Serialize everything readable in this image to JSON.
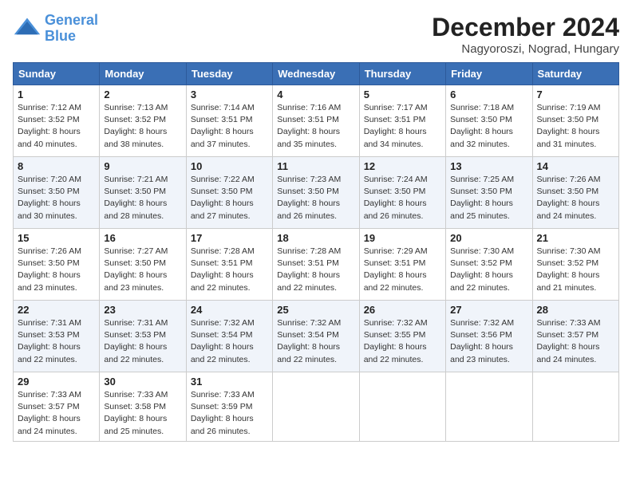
{
  "logo": {
    "line1": "General",
    "line2": "Blue"
  },
  "title": "December 2024",
  "location": "Nagyoroszi, Nograd, Hungary",
  "weekdays": [
    "Sunday",
    "Monday",
    "Tuesday",
    "Wednesday",
    "Thursday",
    "Friday",
    "Saturday"
  ],
  "weeks": [
    [
      {
        "day": 1,
        "sunrise": "7:12 AM",
        "sunset": "3:52 PM",
        "daylight": "8 hours and 40 minutes."
      },
      {
        "day": 2,
        "sunrise": "7:13 AM",
        "sunset": "3:52 PM",
        "daylight": "8 hours and 38 minutes."
      },
      {
        "day": 3,
        "sunrise": "7:14 AM",
        "sunset": "3:51 PM",
        "daylight": "8 hours and 37 minutes."
      },
      {
        "day": 4,
        "sunrise": "7:16 AM",
        "sunset": "3:51 PM",
        "daylight": "8 hours and 35 minutes."
      },
      {
        "day": 5,
        "sunrise": "7:17 AM",
        "sunset": "3:51 PM",
        "daylight": "8 hours and 34 minutes."
      },
      {
        "day": 6,
        "sunrise": "7:18 AM",
        "sunset": "3:50 PM",
        "daylight": "8 hours and 32 minutes."
      },
      {
        "day": 7,
        "sunrise": "7:19 AM",
        "sunset": "3:50 PM",
        "daylight": "8 hours and 31 minutes."
      }
    ],
    [
      {
        "day": 8,
        "sunrise": "7:20 AM",
        "sunset": "3:50 PM",
        "daylight": "8 hours and 30 minutes."
      },
      {
        "day": 9,
        "sunrise": "7:21 AM",
        "sunset": "3:50 PM",
        "daylight": "8 hours and 28 minutes."
      },
      {
        "day": 10,
        "sunrise": "7:22 AM",
        "sunset": "3:50 PM",
        "daylight": "8 hours and 27 minutes."
      },
      {
        "day": 11,
        "sunrise": "7:23 AM",
        "sunset": "3:50 PM",
        "daylight": "8 hours and 26 minutes."
      },
      {
        "day": 12,
        "sunrise": "7:24 AM",
        "sunset": "3:50 PM",
        "daylight": "8 hours and 26 minutes."
      },
      {
        "day": 13,
        "sunrise": "7:25 AM",
        "sunset": "3:50 PM",
        "daylight": "8 hours and 25 minutes."
      },
      {
        "day": 14,
        "sunrise": "7:26 AM",
        "sunset": "3:50 PM",
        "daylight": "8 hours and 24 minutes."
      }
    ],
    [
      {
        "day": 15,
        "sunrise": "7:26 AM",
        "sunset": "3:50 PM",
        "daylight": "8 hours and 23 minutes."
      },
      {
        "day": 16,
        "sunrise": "7:27 AM",
        "sunset": "3:50 PM",
        "daylight": "8 hours and 23 minutes."
      },
      {
        "day": 17,
        "sunrise": "7:28 AM",
        "sunset": "3:51 PM",
        "daylight": "8 hours and 22 minutes."
      },
      {
        "day": 18,
        "sunrise": "7:28 AM",
        "sunset": "3:51 PM",
        "daylight": "8 hours and 22 minutes."
      },
      {
        "day": 19,
        "sunrise": "7:29 AM",
        "sunset": "3:51 PM",
        "daylight": "8 hours and 22 minutes."
      },
      {
        "day": 20,
        "sunrise": "7:30 AM",
        "sunset": "3:52 PM",
        "daylight": "8 hours and 22 minutes."
      },
      {
        "day": 21,
        "sunrise": "7:30 AM",
        "sunset": "3:52 PM",
        "daylight": "8 hours and 21 minutes."
      }
    ],
    [
      {
        "day": 22,
        "sunrise": "7:31 AM",
        "sunset": "3:53 PM",
        "daylight": "8 hours and 22 minutes."
      },
      {
        "day": 23,
        "sunrise": "7:31 AM",
        "sunset": "3:53 PM",
        "daylight": "8 hours and 22 minutes."
      },
      {
        "day": 24,
        "sunrise": "7:32 AM",
        "sunset": "3:54 PM",
        "daylight": "8 hours and 22 minutes."
      },
      {
        "day": 25,
        "sunrise": "7:32 AM",
        "sunset": "3:54 PM",
        "daylight": "8 hours and 22 minutes."
      },
      {
        "day": 26,
        "sunrise": "7:32 AM",
        "sunset": "3:55 PM",
        "daylight": "8 hours and 22 minutes."
      },
      {
        "day": 27,
        "sunrise": "7:32 AM",
        "sunset": "3:56 PM",
        "daylight": "8 hours and 23 minutes."
      },
      {
        "day": 28,
        "sunrise": "7:33 AM",
        "sunset": "3:57 PM",
        "daylight": "8 hours and 24 minutes."
      }
    ],
    [
      {
        "day": 29,
        "sunrise": "7:33 AM",
        "sunset": "3:57 PM",
        "daylight": "8 hours and 24 minutes."
      },
      {
        "day": 30,
        "sunrise": "7:33 AM",
        "sunset": "3:58 PM",
        "daylight": "8 hours and 25 minutes."
      },
      {
        "day": 31,
        "sunrise": "7:33 AM",
        "sunset": "3:59 PM",
        "daylight": "8 hours and 26 minutes."
      },
      null,
      null,
      null,
      null
    ]
  ]
}
